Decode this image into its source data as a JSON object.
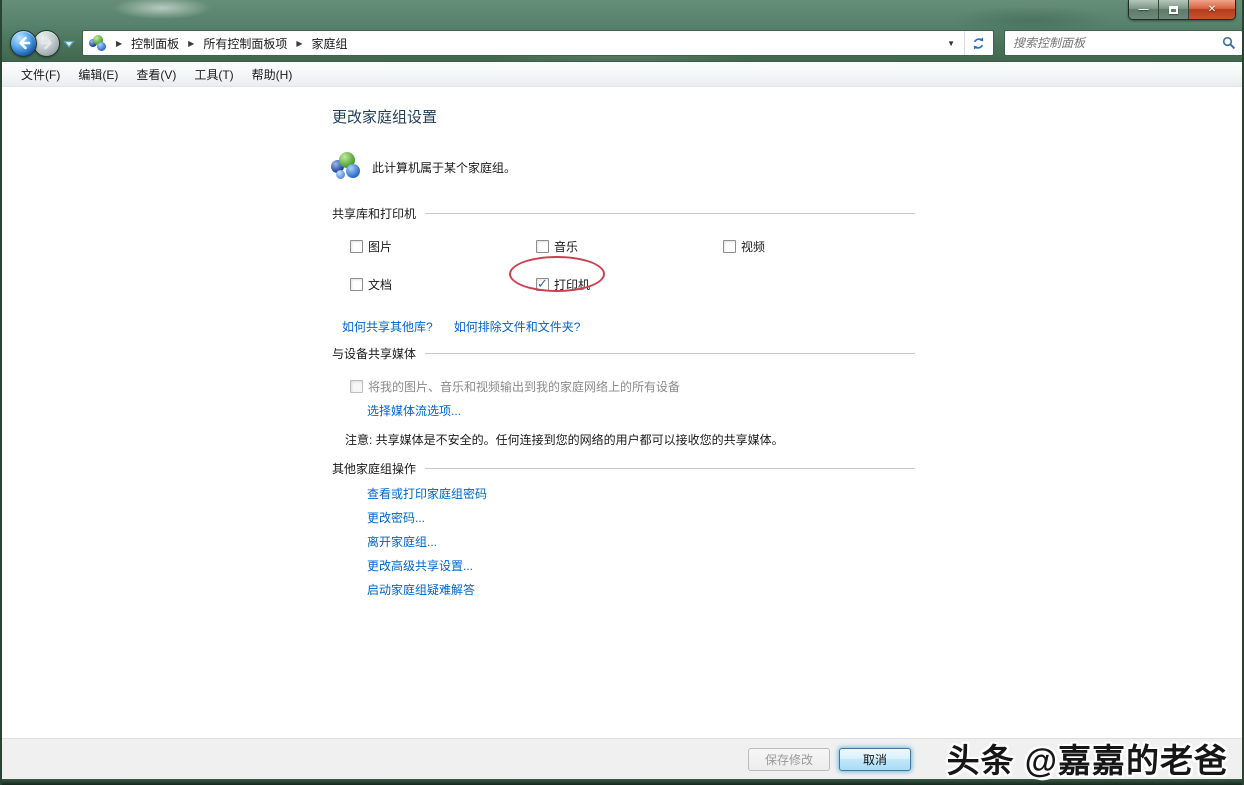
{
  "window": {
    "controls": {
      "minimize_glyph": "—",
      "close_glyph": "✕"
    }
  },
  "nav": {
    "breadcrumb": {
      "separator": "▶",
      "dropdown_glyph": "▼",
      "items": [
        "控制面板",
        "所有控制面板项",
        "家庭组"
      ]
    },
    "search_placeholder": "搜索控制面板"
  },
  "menu": {
    "items": [
      "文件(F)",
      "编辑(E)",
      "查看(V)",
      "工具(T)",
      "帮助(H)"
    ]
  },
  "content": {
    "title": "更改家庭组设置",
    "status_text": "此计算机属于某个家庭组。",
    "share_section": {
      "header": "共享库和打印机",
      "items": [
        {
          "label": "图片",
          "checked": false
        },
        {
          "label": "音乐",
          "checked": false
        },
        {
          "label": "视频",
          "checked": false
        },
        {
          "label": "文档",
          "checked": false
        },
        {
          "label": "打印机",
          "checked": true
        }
      ],
      "links": [
        "如何共享其他库?",
        "如何排除文件和文件夹?"
      ]
    },
    "media_section": {
      "header": "与设备共享媒体",
      "checkbox_label": "将我的图片、音乐和视频输出到我的家庭网络上的所有设备",
      "checkbox_checked": false,
      "stream_link": "选择媒体流选项...",
      "note": "注意: 共享媒体是不安全的。任何连接到您的网络的用户都可以接收您的共享媒体。"
    },
    "actions_section": {
      "header": "其他家庭组操作",
      "links": [
        "查看或打印家庭组密码",
        "更改密码...",
        "离开家庭组...",
        "更改高级共享设置...",
        "启动家庭组疑难解答"
      ]
    }
  },
  "footer": {
    "save_label": "保存修改",
    "cancel_label": "取消"
  },
  "watermark": "头条 @嘉嘉的老爸",
  "colors": {
    "link": "#0066cc",
    "annotation": "#cc4050",
    "title_text": "#1f3d5c",
    "glass_green": "#57826b"
  }
}
